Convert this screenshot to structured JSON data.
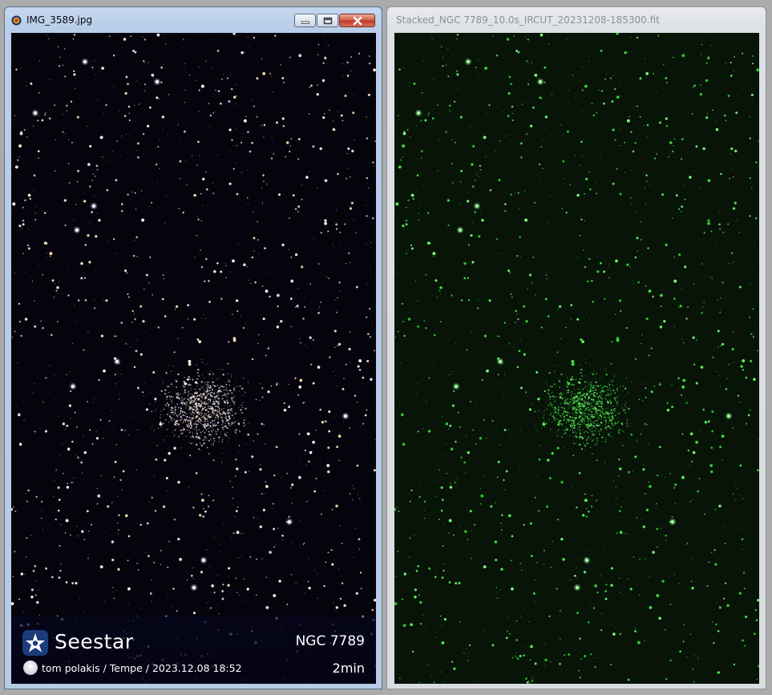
{
  "windows": {
    "left": {
      "title": "IMG_3589.jpg",
      "icon": "app-icon",
      "controls": [
        "minimize-icon",
        "maximize-icon",
        "close-icon"
      ],
      "overlay": {
        "brand": "Seestar",
        "target": "NGC 7789",
        "credit": "tom polakis / Tempe / 2023.12.08 18:52",
        "duration": "2min"
      }
    },
    "right": {
      "title": "Stacked_NGC 7789_10.0s_IRCUT_20231208-185300.fit"
    }
  },
  "colors": {
    "left_background": "#05040d",
    "right_background": "#071407",
    "right_star": "#57ff57",
    "active_titlebar": "#b7cde8",
    "inactive_titlebar": "#dcdfe4",
    "close_button": "#c0392b"
  }
}
